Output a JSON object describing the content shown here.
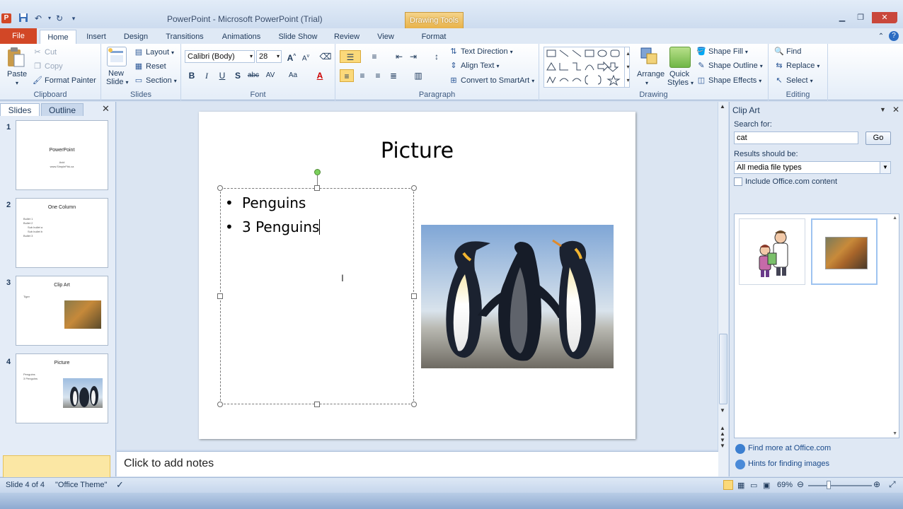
{
  "window": {
    "title": "PowerPoint  -  Microsoft PowerPoint (Trial)",
    "contextual_tab": "Drawing Tools",
    "app_icon_letter": "P"
  },
  "ribbon_tabs": [
    "File",
    "Home",
    "Insert",
    "Design",
    "Transitions",
    "Animations",
    "Slide Show",
    "Review",
    "View",
    "Format"
  ],
  "clipboard": {
    "paste": "Paste",
    "cut": "Cut",
    "copy": "Copy",
    "format_painter": "Format Painter",
    "label": "Clipboard"
  },
  "slides_group": {
    "new_slide_1": "New",
    "new_slide_2": "Slide",
    "layout": "Layout",
    "reset": "Reset",
    "section": "Section",
    "label": "Slides"
  },
  "font_group": {
    "font_name": "Calibri (Body)",
    "font_size": "28",
    "label": "Font"
  },
  "paragraph_group": {
    "text_direction": "Text Direction",
    "align_text": "Align Text",
    "convert_smartart": "Convert to SmartArt",
    "label": "Paragraph"
  },
  "drawing_group": {
    "arrange": "Arrange",
    "quick_styles_1": "Quick",
    "quick_styles_2": "Styles",
    "shape_fill": "Shape Fill",
    "shape_outline": "Shape Outline",
    "shape_effects": "Shape Effects",
    "label": "Drawing"
  },
  "editing_group": {
    "find": "Find",
    "replace": "Replace",
    "select": "Select",
    "label": "Editing"
  },
  "left_panel": {
    "tabs": [
      "Slides",
      "Outline"
    ],
    "thumbnails": [
      {
        "num": "1",
        "title": "PowerPoint",
        "lines": [
          "Avid",
          "www.SimpleFbk.ca"
        ]
      },
      {
        "num": "2",
        "title": "One Column",
        "lines": [
          "Bullet 1",
          "Bullet 2",
          "Sub bullet a",
          "Sub bullet b",
          "Bullet 3"
        ]
      },
      {
        "num": "3",
        "title": "Clip Art",
        "lines": [
          "Tiger"
        ]
      },
      {
        "num": "4",
        "title": "Picture",
        "lines": [
          "Penguins",
          "3 Penguins"
        ]
      }
    ]
  },
  "slide": {
    "title": "Picture",
    "bullets": [
      "Penguins",
      "3 Penguins"
    ]
  },
  "notes": {
    "placeholder": "Click to add notes"
  },
  "clip_art": {
    "title": "Clip Art",
    "search_label": "Search for:",
    "search_value": "cat",
    "go": "Go",
    "results_label": "Results should be:",
    "results_value": "All media file types",
    "include_office": "Include Office.com content",
    "find_more": "Find more at Office.com",
    "hints": "Hints for finding images"
  },
  "status": {
    "slide_info": "Slide 4 of 4",
    "theme": "\"Office Theme\"",
    "zoom": "69%"
  }
}
